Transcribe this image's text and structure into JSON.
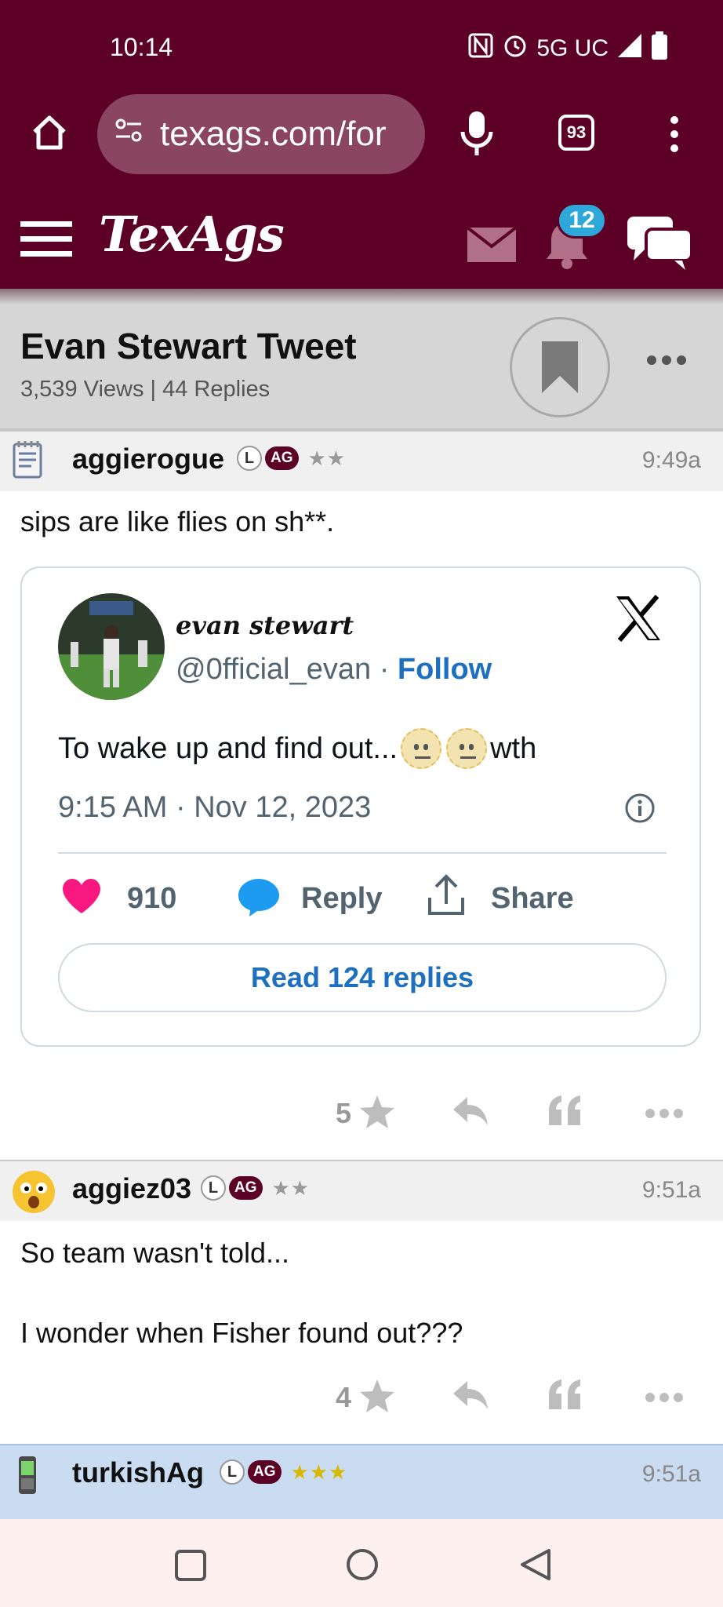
{
  "status_bar": {
    "time": "10:14",
    "network": "5G UC"
  },
  "browser": {
    "url": "texags.com/for",
    "tab_count": "93"
  },
  "site": {
    "logo": "TexAgs",
    "notification_count": "12"
  },
  "thread": {
    "title": "Evan Stewart Tweet",
    "meta": "3,539 Views | 44 Replies"
  },
  "posts": [
    {
      "username": "aggierogue",
      "tag_l": "L",
      "tag_ag": "AG",
      "stars": "★★",
      "time": "9:49a",
      "body": "sips are like flies on sh**.",
      "star_count": "5"
    },
    {
      "username": "aggiez03",
      "tag_l": "L",
      "tag_ag": "AG",
      "stars": "★★",
      "time": "9:51a",
      "body_line1": "So team wasn't told...",
      "body_line2": "I wonder when Fisher found out???",
      "star_count": "4"
    },
    {
      "username": "turkishAg",
      "tag_l": "L",
      "tag_ag": "AG",
      "stars": "★★★",
      "time": "9:51a"
    }
  ],
  "tweet": {
    "display_name": "evan stewart",
    "handle": "@0fficial_evan",
    "separator": " · ",
    "follow_label": "Follow",
    "text_before": "To wake up and find out...",
    "text_after": "wth",
    "date": "9:15 AM · Nov 12, 2023",
    "likes": "910",
    "reply_label": "Reply",
    "share_label": "Share",
    "read_replies_label": "Read 124 replies"
  },
  "colors": {
    "brand": "#5c0025",
    "link": "#1d6fc0",
    "like": "#f91880",
    "highlight_row": "#c9dcf2"
  }
}
